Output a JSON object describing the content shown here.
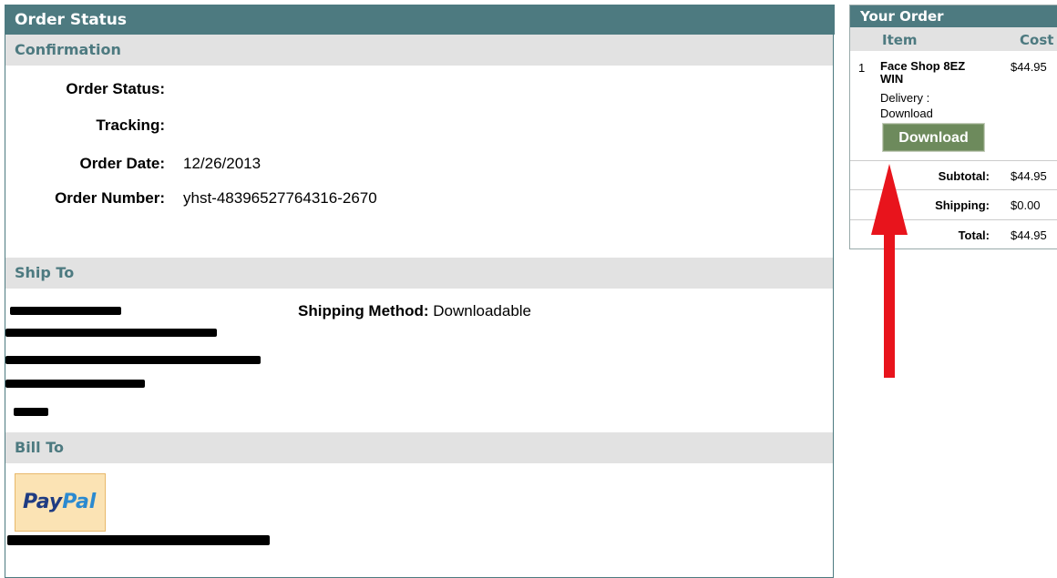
{
  "main": {
    "title": "Order Status",
    "confirmation": {
      "section_title": "Confirmation",
      "rows": [
        {
          "label": "Order Status:",
          "value": ""
        },
        {
          "label": "Tracking:",
          "value": ""
        },
        {
          "label": "Order Date:",
          "value": "12/26/2013"
        },
        {
          "label": "Order Number:",
          "value": "yhst-48396527764316-2670"
        }
      ]
    },
    "ship_to": {
      "section_title": "Ship To",
      "shipping_method_label": "Shipping Method:",
      "shipping_method_value": "Downloadable"
    },
    "bill_to": {
      "section_title": "Bill To",
      "paypal_pay": "Pay",
      "paypal_pal": "Pal"
    }
  },
  "order": {
    "title": "Your Order",
    "col_item": "Item",
    "col_cost": "Cost",
    "item": {
      "num": "1",
      "name": "Face Shop 8EZ WIN",
      "price": "$44.95",
      "delivery": "Delivery : Download",
      "button": "Download"
    },
    "subtotal_label": "Subtotal:",
    "subtotal_value": "$44.95",
    "shipping_label": "Shipping:",
    "shipping_value": "$0.00",
    "total_label": "Total:",
    "total_value": "$44.95"
  },
  "colors": {
    "header": "#4d7a80",
    "section_bg": "#e2e2e2",
    "button": "#6d8a5c",
    "arrow": "#e8141c"
  }
}
